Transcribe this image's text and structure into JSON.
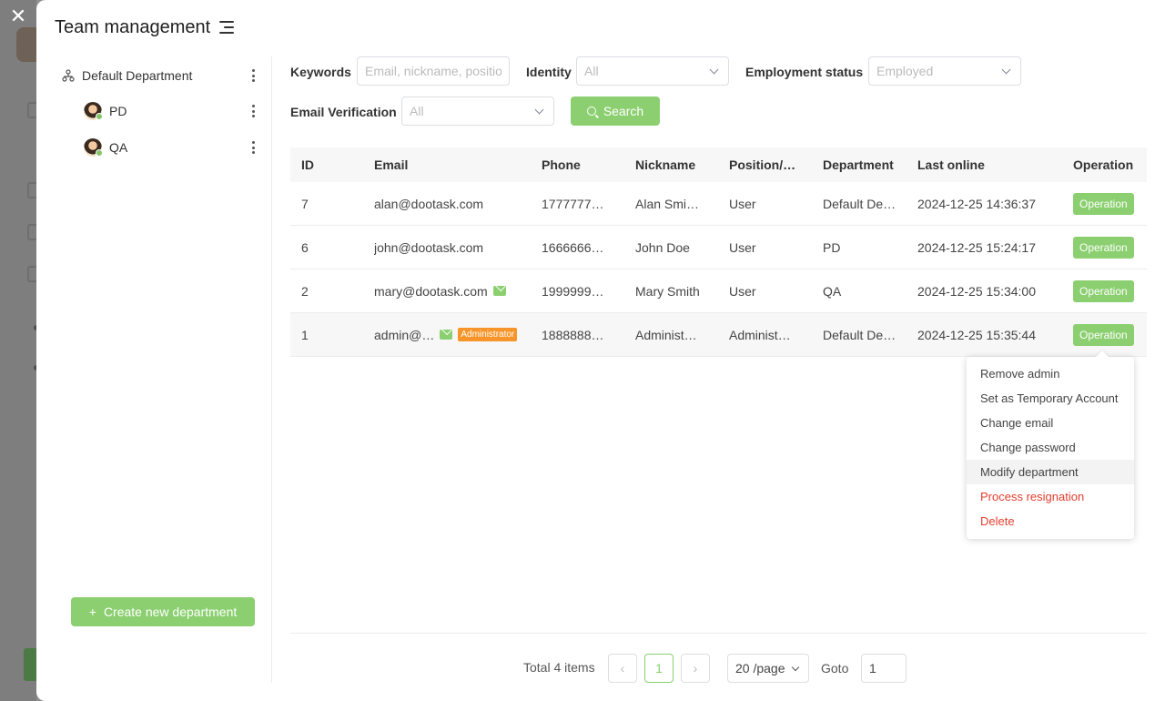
{
  "modal": {
    "title": "Team management"
  },
  "departments": [
    {
      "label": "Default Department"
    },
    {
      "label": "PD"
    },
    {
      "label": "QA"
    }
  ],
  "create_button_label": "Create new department",
  "filters": {
    "keywords_label": "Keywords",
    "keywords_placeholder": "Email, nickname, position",
    "identity_label": "Identity",
    "identity_value": "All",
    "employment_label": "Employment status",
    "employment_value": "Employed",
    "email_verification_label": "Email Verification",
    "email_verification_value": "All",
    "search_label": "Search"
  },
  "table": {
    "columns": [
      "ID",
      "Email",
      "Phone",
      "Nickname",
      "Position/…",
      "Department",
      "Last online",
      "Operation"
    ],
    "rows": [
      {
        "id": "7",
        "email": "alan@dootask.com",
        "phone": "1777777…",
        "nickname": "Alan Smi…",
        "position": "User",
        "department": "Default De…",
        "last_online": "2024-12-25 14:36:37",
        "op": "Operation"
      },
      {
        "id": "6",
        "email": "john@dootask.com",
        "phone": "1666666…",
        "nickname": "John Doe",
        "position": "User",
        "department": "PD",
        "last_online": "2024-12-25 15:24:17",
        "op": "Operation"
      },
      {
        "id": "2",
        "email": "mary@dootask.com",
        "phone": "1999999…",
        "nickname": "Mary Smith",
        "position": "User",
        "department": "QA",
        "last_online": "2024-12-25 15:34:00",
        "op": "Operation"
      },
      {
        "id": "1",
        "email": "admin@…",
        "phone": "1888888…",
        "nickname": "Administ…",
        "position": "Administ…",
        "department": "Default De…",
        "last_online": "2024-12-25 15:35:44",
        "op": "Operation",
        "badge": "Administrator"
      }
    ]
  },
  "dropdown": {
    "items": [
      "Remove admin",
      "Set as Temporary Account",
      "Change email",
      "Change password",
      "Modify department",
      "Process resignation",
      "Delete"
    ]
  },
  "pagination": {
    "total": "Total 4 items",
    "current_page": "1",
    "page_size": "20 /page",
    "goto_label": "Goto",
    "goto_value": "1"
  },
  "colors": {
    "accent": "#8bcf70",
    "danger": "#e33d2f",
    "badge": "#f7952b"
  }
}
